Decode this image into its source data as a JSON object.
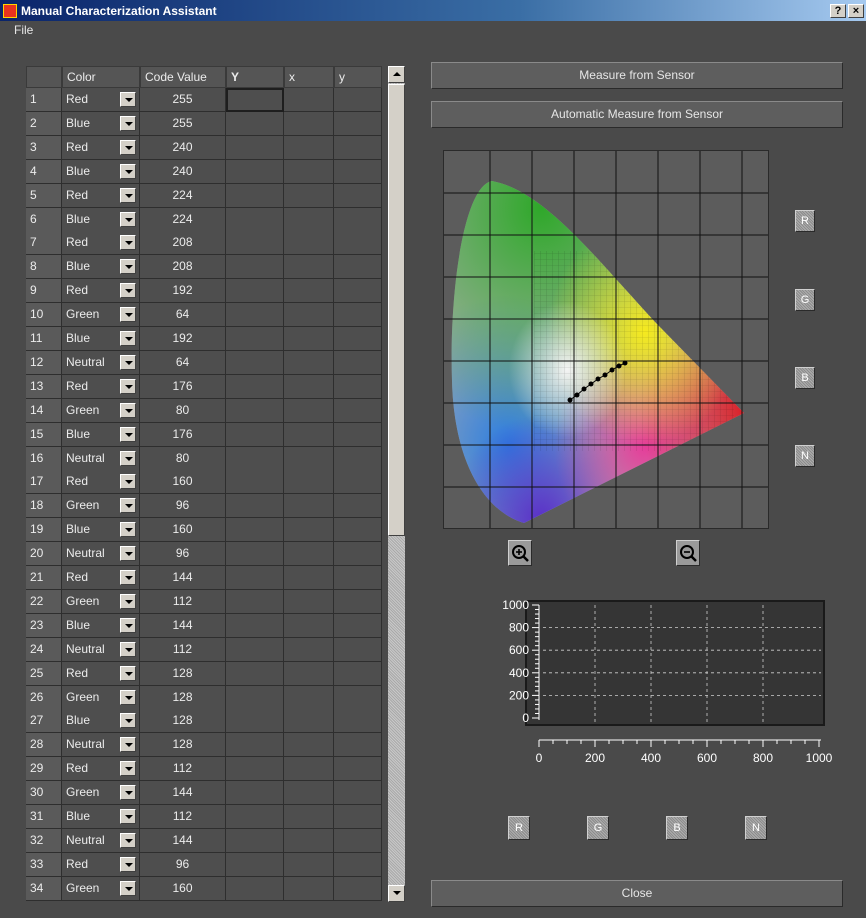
{
  "window": {
    "title": "Manual Characterization Assistant",
    "help_label": "?",
    "close_label": "×"
  },
  "menu": {
    "file": "File"
  },
  "table": {
    "headers": {
      "num": "",
      "color": "Color",
      "code": "Code Value",
      "Y": "Y",
      "x": "x",
      "y": "y"
    },
    "rows": [
      {
        "n": "1",
        "color": "Red",
        "code": "255"
      },
      {
        "n": "2",
        "color": "Blue",
        "code": "255"
      },
      {
        "n": "3",
        "color": "Red",
        "code": "240"
      },
      {
        "n": "4",
        "color": "Blue",
        "code": "240"
      },
      {
        "n": "5",
        "color": "Red",
        "code": "224"
      },
      {
        "n": "6",
        "color": "Blue",
        "code": "224"
      },
      {
        "n": "7",
        "color": "Red",
        "code": "208"
      },
      {
        "n": "8",
        "color": "Blue",
        "code": "208"
      },
      {
        "n": "9",
        "color": "Red",
        "code": "192"
      },
      {
        "n": "10",
        "color": "Green",
        "code": "64"
      },
      {
        "n": "11",
        "color": "Blue",
        "code": "192"
      },
      {
        "n": "12",
        "color": "Neutral",
        "code": "64"
      },
      {
        "n": "13",
        "color": "Red",
        "code": "176"
      },
      {
        "n": "14",
        "color": "Green",
        "code": "80"
      },
      {
        "n": "15",
        "color": "Blue",
        "code": "176"
      },
      {
        "n": "16",
        "color": "Neutral",
        "code": "80"
      },
      {
        "n": "17",
        "color": "Red",
        "code": "160"
      },
      {
        "n": "18",
        "color": "Green",
        "code": "96"
      },
      {
        "n": "19",
        "color": "Blue",
        "code": "160"
      },
      {
        "n": "20",
        "color": "Neutral",
        "code": "96"
      },
      {
        "n": "21",
        "color": "Red",
        "code": "144"
      },
      {
        "n": "22",
        "color": "Green",
        "code": "112"
      },
      {
        "n": "23",
        "color": "Blue",
        "code": "144"
      },
      {
        "n": "24",
        "color": "Neutral",
        "code": "112"
      },
      {
        "n": "25",
        "color": "Red",
        "code": "128"
      },
      {
        "n": "26",
        "color": "Green",
        "code": "128"
      },
      {
        "n": "27",
        "color": "Blue",
        "code": "128"
      },
      {
        "n": "28",
        "color": "Neutral",
        "code": "128"
      },
      {
        "n": "29",
        "color": "Red",
        "code": "112"
      },
      {
        "n": "30",
        "color": "Green",
        "code": "144"
      },
      {
        "n": "31",
        "color": "Blue",
        "code": "112"
      },
      {
        "n": "32",
        "color": "Neutral",
        "code": "144"
      },
      {
        "n": "33",
        "color": "Red",
        "code": "96"
      },
      {
        "n": "34",
        "color": "Green",
        "code": "160"
      }
    ]
  },
  "buttons": {
    "measure": "Measure from Sensor",
    "auto_measure": "Automatic Measure from Sensor",
    "close": "Close"
  },
  "channel_buttons": [
    "R",
    "G",
    "B",
    "N"
  ],
  "zoom": {
    "in_icon": "zoom-in-icon",
    "out_icon": "zoom-out-icon"
  },
  "plot": {
    "y_ticks": [
      "1000",
      "800",
      "600",
      "400",
      "200",
      "0"
    ],
    "x_ticks": [
      "0",
      "200",
      "400",
      "600",
      "800",
      "1000"
    ]
  },
  "colors": {
    "window_bg": "#4a4a4a",
    "title_start": "#0a246a",
    "title_end": "#a6caf0"
  }
}
